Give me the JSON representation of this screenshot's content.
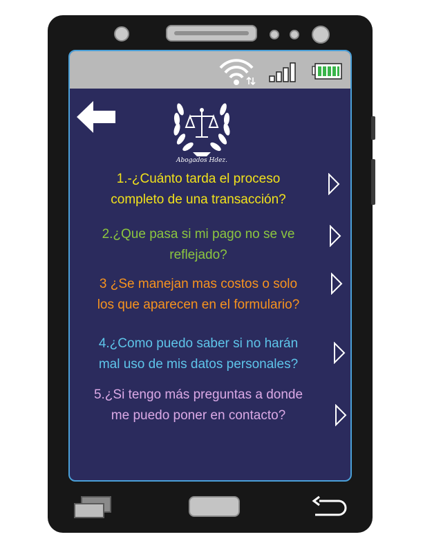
{
  "header": {
    "logo_text": "Abogados Hdez."
  },
  "faq": [
    {
      "line1": "1.-¿Cuánto tarda el proceso",
      "line2": "completo de una transacción?",
      "color": "#f2e21b"
    },
    {
      "line1": "2.¿Que pasa si mi pago no se ve",
      "line2": "reflejado?",
      "color": "#8cc63f"
    },
    {
      "line1": "3 ¿Se manejan mas costos o solo",
      "line2": "los que aparecen en el formulario?",
      "color": "#f7931e"
    },
    {
      "line1": "4.¿Como puedo saber si no harán",
      "line2": "mal uso de mis datos personales?",
      "color": "#5ec5ea"
    },
    {
      "line1": "5.¿Si tengo más preguntas a donde",
      "line2": "me puedo poner en contacto?",
      "color": "#dba9e6"
    }
  ],
  "icons": {
    "status": [
      "wifi-icon",
      "signal-icon",
      "battery-icon"
    ],
    "nav": [
      "recent-apps-icon",
      "home-button",
      "back-icon"
    ],
    "screen_back": "left-arrow-icon"
  },
  "colors": {
    "screen_bg": "#2b2b5d",
    "statusbar_bg": "#b9b9b9",
    "screen_border": "#4aa0d8",
    "battery": "#39b54a"
  }
}
